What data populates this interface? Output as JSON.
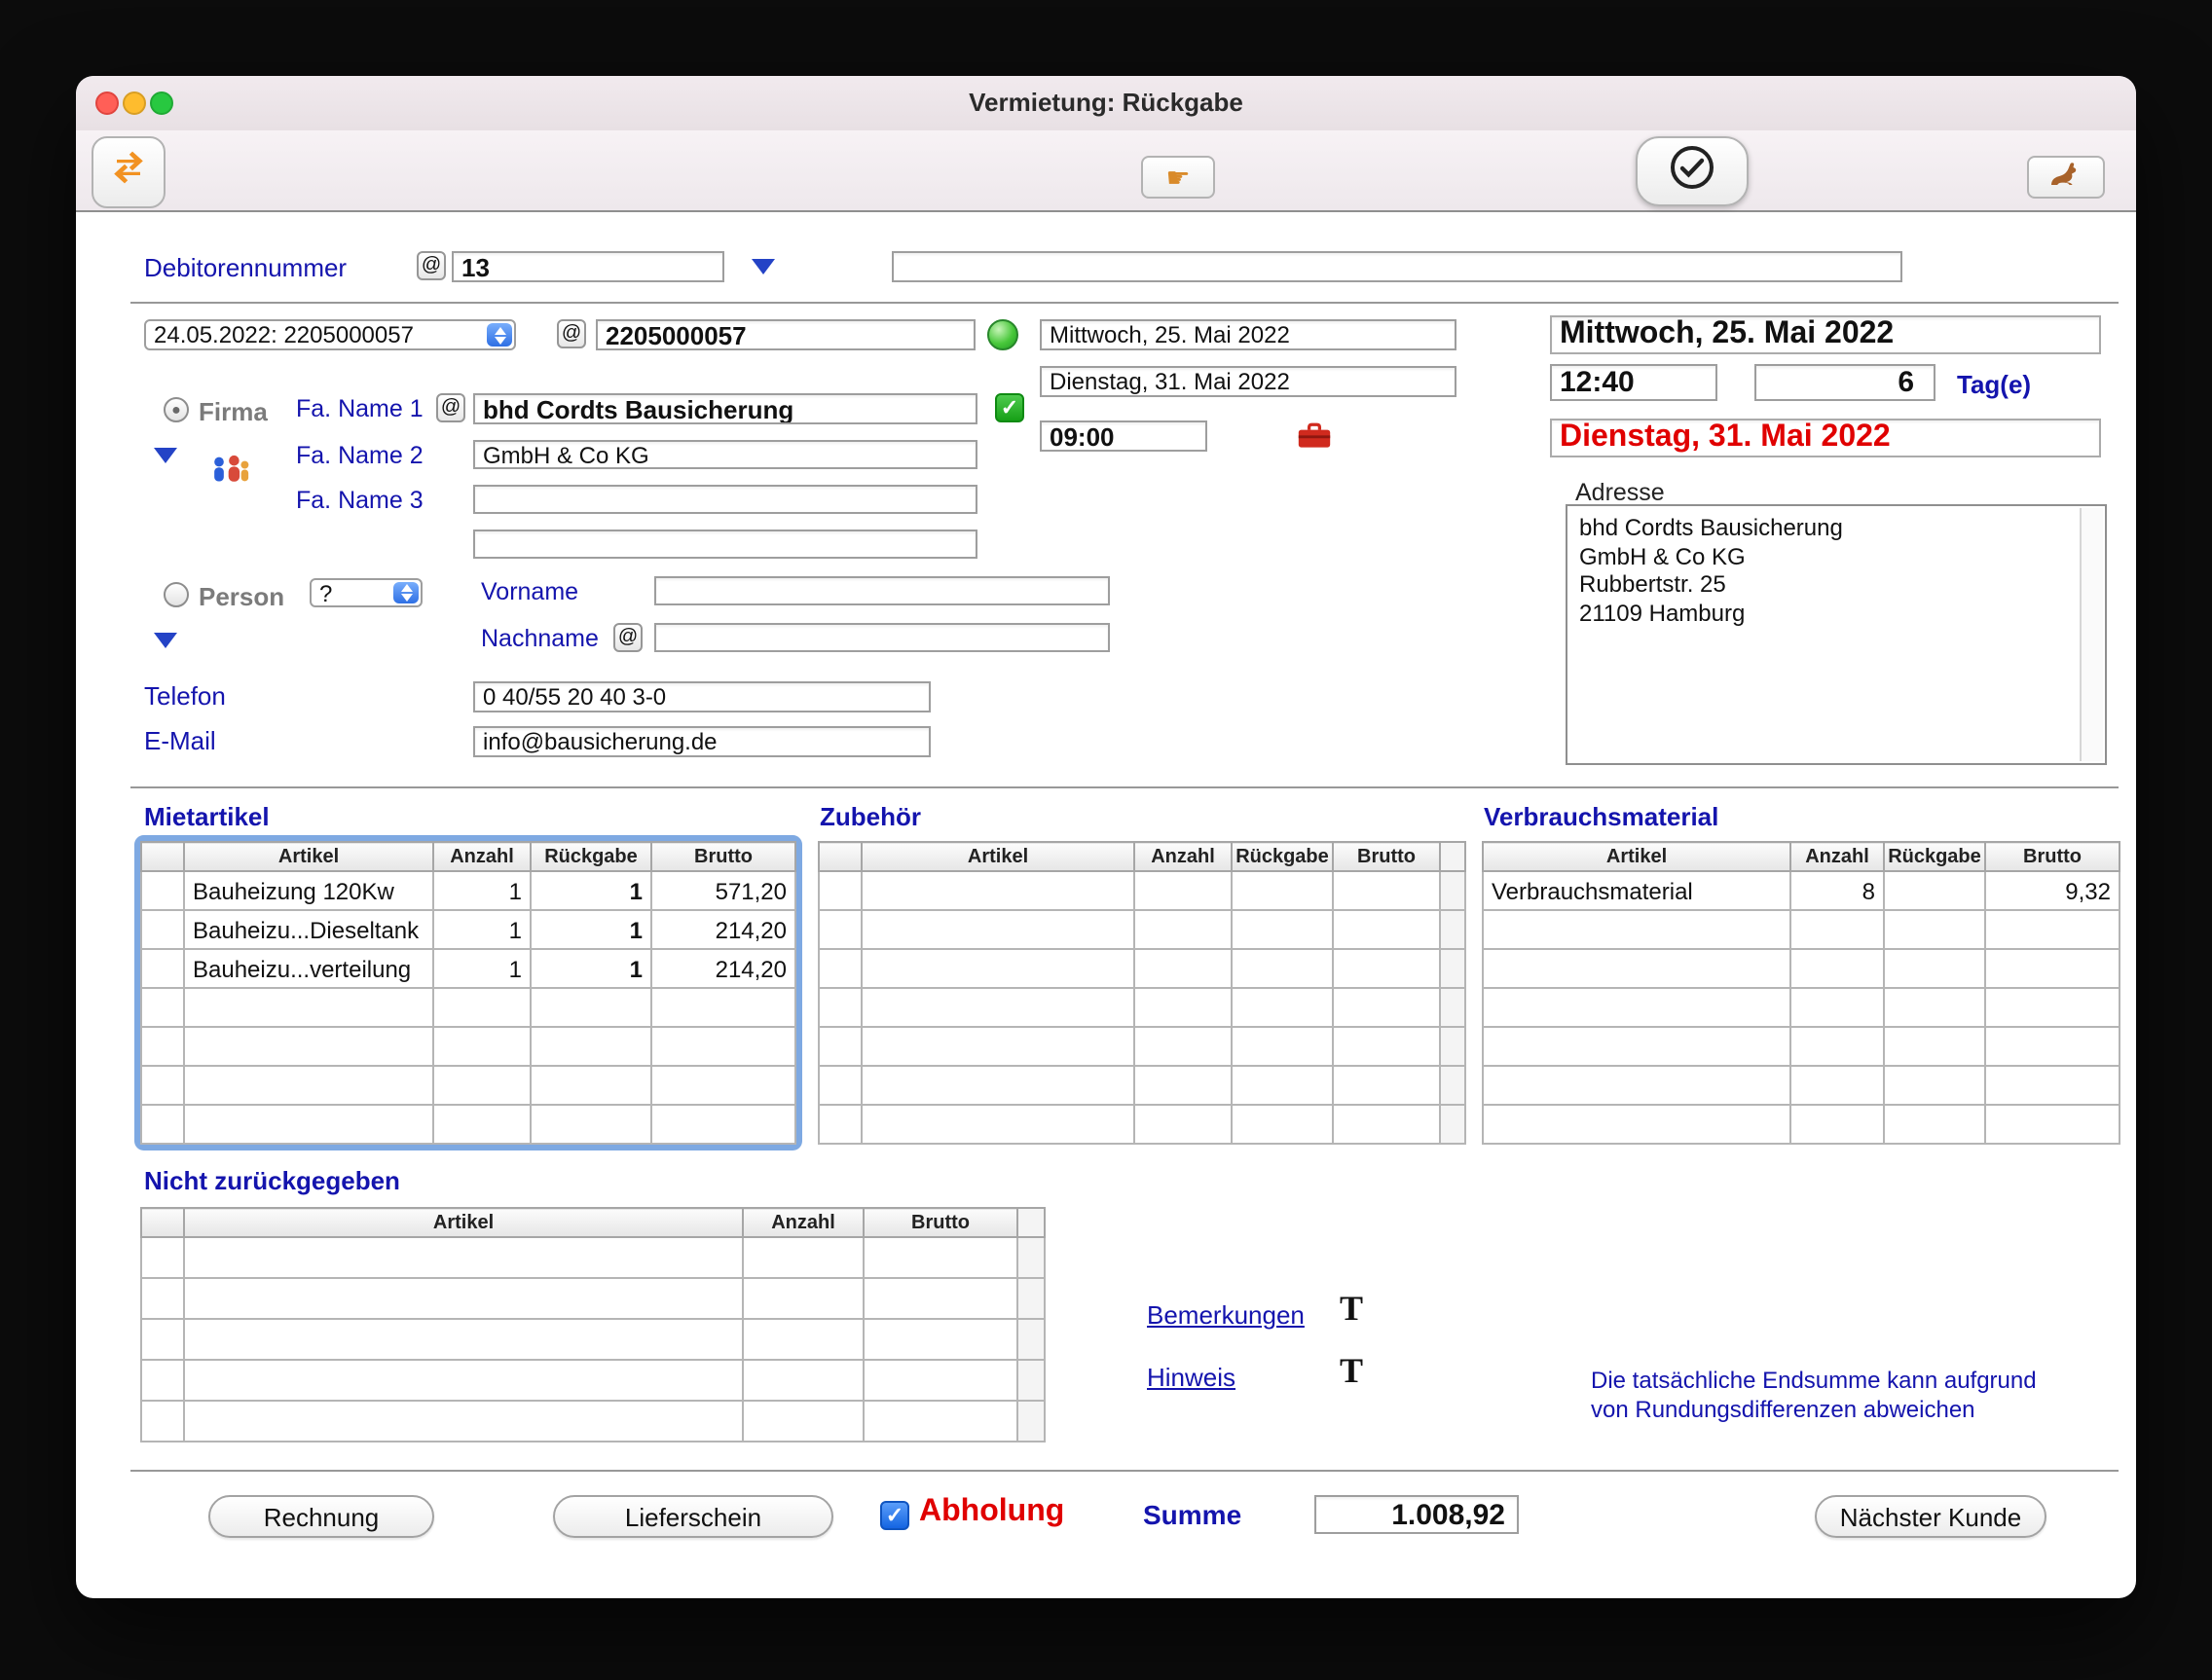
{
  "window": {
    "title": "Vermietung: Rückgabe"
  },
  "toolbar": {
    "module_icon": "orange-swap-arrows",
    "goto_glyph": "☛",
    "confirm_icon": "check-circle",
    "kangaroo_icon": "kangaroo"
  },
  "debitor": {
    "label": "Debitorennummer",
    "at": "@",
    "value": "13",
    "extra_value": ""
  },
  "rental": {
    "history_select": "24.05.2022: 2205000057",
    "at": "@",
    "number": "2205000057",
    "start_date": "Mittwoch, 25. Mai 2022",
    "end_date": "Dienstag, 31. Mai 2022",
    "start_time": "09:00"
  },
  "summary": {
    "return_date": "Mittwoch, 25. Mai 2022",
    "return_time": "12:40",
    "days_value": "6",
    "days_label": "Tag(e)",
    "end_date": "Dienstag, 31. Mai 2022"
  },
  "customer": {
    "firma_label": "Firma",
    "firma_radio_dot": "●",
    "person_label": "Person",
    "person_radio_dot": "",
    "fa_name1_label": "Fa. Name 1",
    "fa_name2_label": "Fa. Name 2",
    "fa_name3_label": "Fa. Name 3",
    "at": "@",
    "fa_name1": "bhd Cordts Bausicherung",
    "fa_name1_check": "✓",
    "fa_name2": "GmbH & Co KG",
    "fa_name3": "",
    "fa_name4": "",
    "person_select": "?",
    "vorname_label": "Vorname",
    "vorname": "",
    "nachname_label": "Nachname",
    "nachname": "",
    "telefon_label": "Telefon",
    "telefon": "0 40/55 20 40 3-0",
    "email_label": "E-Mail",
    "email": "info@bausicherung.de"
  },
  "adresse": {
    "label": "Adresse",
    "text": "bhd Cordts Bausicherung\nGmbH & Co KG\nRubbertstr. 25\n21109 Hamburg"
  },
  "tables": {
    "mietartikel": {
      "title": "Mietartikel",
      "headers": [
        "Artikel",
        "Anzahl",
        "Rückgabe",
        "Brutto"
      ],
      "rows": [
        [
          "Bauheizung 120Kw",
          "1",
          "1",
          "571,20"
        ],
        [
          "Bauheizu...Dieseltank",
          "1",
          "1",
          "214,20"
        ],
        [
          "Bauheizu...verteilung",
          "1",
          "1",
          "214,20"
        ]
      ],
      "total_rows": 7
    },
    "zubehoer": {
      "title": "Zubehör",
      "headers": [
        "Artikel",
        "Anzahl",
        "Rückgabe",
        "Brutto"
      ],
      "rows": [],
      "total_rows": 7
    },
    "verbrauchsmaterial": {
      "title": "Verbrauchsmaterial",
      "headers": [
        "Artikel",
        "Anzahl",
        "Rückgabe",
        "Brutto"
      ],
      "rows": [
        [
          "Verbrauchsmaterial",
          "8",
          "",
          "9,32"
        ]
      ],
      "total_rows": 7
    },
    "nicht_zurueckgegeben": {
      "title": "Nicht zurückgegeben",
      "headers": [
        "Artikel",
        "Anzahl",
        "Brutto"
      ],
      "rows": [],
      "total_rows": 5
    }
  },
  "notes": {
    "bemerkungen_label": "Bemerkungen",
    "hinweis_label": "Hinweis",
    "text_icon": "T",
    "disclaimer_line1": "Die tatsächliche Endsumme kann aufgrund",
    "disclaimer_line2": "von Rundungsdifferenzen abweichen"
  },
  "footer": {
    "rechnung_button": "Rechnung",
    "lieferschein_button": "Lieferschein",
    "abholung_label": "Abholung",
    "abholung_check": "✓",
    "summe_label": "Summe",
    "summe_value": "1.008,92",
    "naechster_kunde_button": "Nächster Kunde"
  },
  "colors": {
    "label_blue": "#1414ad",
    "alert_red": "#e00000",
    "status_green": "#35c135",
    "focus_ring": "#7ea9e2"
  }
}
